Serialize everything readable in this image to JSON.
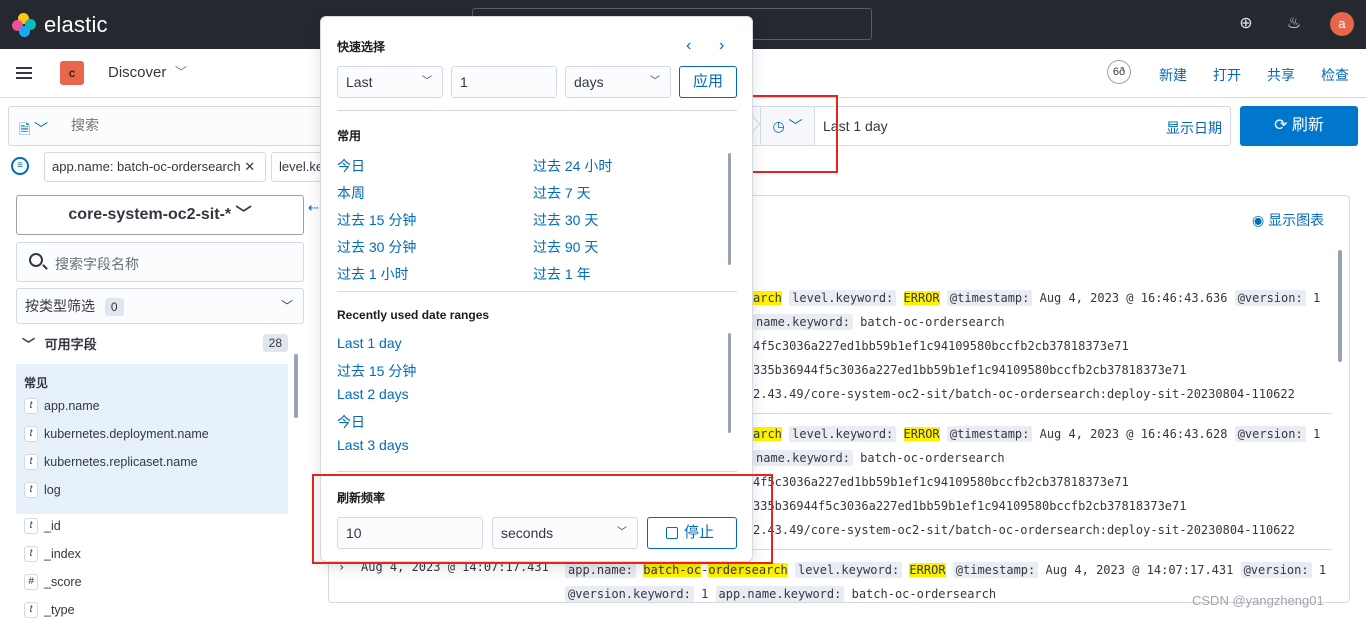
{
  "header": {
    "brand": "elastic",
    "avatar_letter": "a"
  },
  "appbar": {
    "space_letter": "c",
    "breadcrumb": "Discover",
    "help_label": "6ð",
    "links": [
      "新建",
      "打开",
      "共享",
      "检查"
    ]
  },
  "query": {
    "placeholder": "搜索",
    "date_text": "Last 1 day",
    "show_dates": "显示日期",
    "refresh": "刷新"
  },
  "filters": [
    "app.name: batch-oc-ordersearch",
    "level.ke"
  ],
  "sidebar": {
    "index_pattern": "core-system-oc2-sit-*",
    "field_search_placeholder": "搜索字段名称",
    "type_filter_label": "按类型筛选",
    "type_filter_count": "0",
    "available_label": "可用字段",
    "available_count": "28",
    "common_label": "常见",
    "common_fields": [
      {
        "type": "t",
        "name": "app.name"
      },
      {
        "type": "t",
        "name": "kubernetes.deployment.name"
      },
      {
        "type": "t",
        "name": "kubernetes.replicaset.name"
      },
      {
        "type": "t",
        "name": "log"
      }
    ],
    "other_fields": [
      {
        "type": "t",
        "name": "_id"
      },
      {
        "type": "t",
        "name": "_index"
      },
      {
        "type": "#",
        "name": "_score"
      },
      {
        "type": "t",
        "name": "_type"
      }
    ]
  },
  "main": {
    "show_chart": "显示图表",
    "doc1": {
      "line1_prefix": "arch",
      "level_key": "level.keyword:",
      "level_val": "ERROR",
      "ts_key": "@timestamp:",
      "ts_val": "Aug 4, 2023 @ 16:46:43.636",
      "ver_key": "@version:",
      "ver_val": "1",
      "line2_key": "name.keyword:",
      "line2_val": "batch-oc-ordersearch",
      "line3": "4f5c3036a227ed1bb59b1ef1c94109580bccfb2cb37818373e71",
      "line4": "335b36944f5c3036a227ed1bb59b1ef1c94109580bccfb2cb37818373e71",
      "line5": "2.43.49/core-system-oc2-sit/batch-oc-ordersearch:deploy-sit-20230804-110622"
    },
    "doc2": {
      "line1_prefix": "arch",
      "level_key": "level.keyword:",
      "level_val": "ERROR",
      "ts_key": "@timestamp:",
      "ts_val": "Aug 4, 2023 @ 16:46:43.628",
      "ver_key": "@version:",
      "ver_val": "1",
      "line2_key": "name.keyword:",
      "line2_val": "batch-oc-ordersearch",
      "line3": "4f5c3036a227ed1bb59b1ef1c94109580bccfb2cb37818373e71",
      "line4": "335b36944f5c3036a227ed1bb59b1ef1c94109580bccfb2cb37818373e71",
      "line5": "2.43.49/core-system-oc2-sit/batch-oc-ordersearch:deploy-sit-20230804-110622"
    },
    "doc3": {
      "time": "Aug 4, 2023 @ 14:07:17.431",
      "app_key": "app.name:",
      "app_val_a": "batch-",
      "app_val_b": "oc",
      "app_val_c": "-",
      "app_val_d": "ordersearch",
      "level_key": "level.keyword:",
      "level_val": "ERROR",
      "ts_key": "@timestamp:",
      "ts_val": "Aug 4, 2023 @ 14:07:17.431",
      "ver_key": "@version:",
      "ver_val": "1",
      "line2_key1": "@version.keyword:",
      "line2_val1": "1",
      "line2_key2": "app.name.keyword:",
      "line2_val2": "batch-oc-ordersearch"
    }
  },
  "popover": {
    "quick_title": "快速选择",
    "unit_dir": "Last",
    "amount": "1",
    "unit": "days",
    "apply": "应用",
    "common_title": "常用",
    "common_left": [
      "今日",
      "本周",
      "过去 15 分钟",
      "过去 30 分钟",
      "过去 1 小时"
    ],
    "common_right": [
      "过去 24 小时",
      "过去 7 天",
      "过去 30 天",
      "过去 90 天",
      "过去 1 年"
    ],
    "recent_title": "Recently used date ranges",
    "recent": [
      "Last 1 day",
      "过去 15 分钟",
      "Last 2 days",
      "今日",
      "Last 3 days"
    ],
    "refresh_title": "刷新频率",
    "refresh_value": "10",
    "refresh_unit": "seconds",
    "stop": "停止"
  },
  "watermark": "CSDN @yangzheng01",
  "colors": {
    "accent": "#006bb8",
    "primary_button": "#0077cc",
    "annotation_red": "#e5231f",
    "highlight": "#fff200"
  }
}
